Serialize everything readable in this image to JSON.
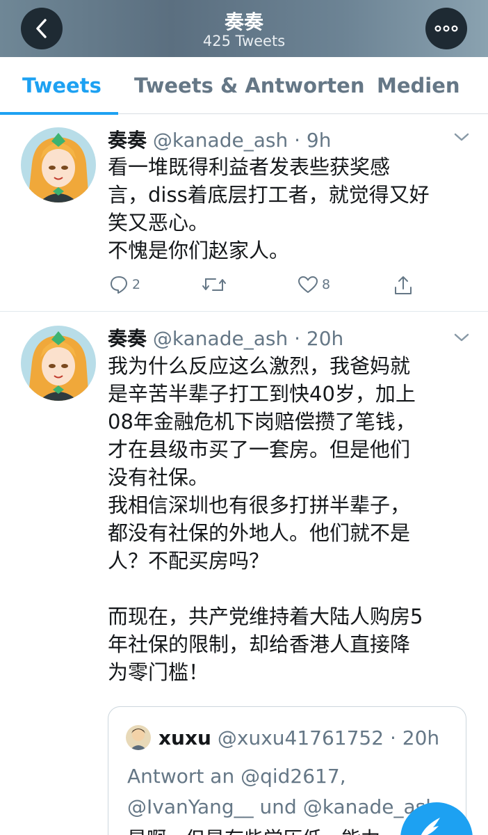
{
  "header": {
    "title": "奏奏",
    "subtitle": "425 Tweets"
  },
  "tabs": [
    {
      "label": "Tweets",
      "active": true
    },
    {
      "label": "Tweets & Antworten",
      "active": false
    },
    {
      "label": "Medien",
      "active": false
    }
  ],
  "tweets": [
    {
      "name": "奏奏",
      "handle": "@kanade_ash · 9h",
      "text": "看一堆既得利益者发表些获奖感\n言，diss着底层打工者，就觉得又好\n笑又恶心。\n不愧是你们赵家人。",
      "replies": "2",
      "retweets": "",
      "likes": "8"
    },
    {
      "name": "奏奏",
      "handle": "@kanade_ash · 20h",
      "text": "我为什么反应这么激烈，我爸妈就\n是辛苦半辈子打工到快40岁，加上\n08年金融危机下岗赔偿攒了笔钱，\n才在县级市买了一套房。但是他们\n没有社保。\n我相信深圳也有很多打拼半辈子，\n都没有社保的外地人。他们就不是\n人？不配买房吗？\n\n而现在，共产党维持着大陆人购房5\n年社保的限制，却给香港人直接降\n为零门槛！",
      "quote": {
        "name": "xuxu",
        "handle": "@xuxu41761752 · 20h",
        "reply_line1": "Antwort an @qid2617,",
        "reply_line2": "@IvanYang__ und @kanade_ash",
        "body": "是啊，但是有些学历低，能力"
      }
    }
  ],
  "colors": {
    "accent": "#1da1f2",
    "secondary_text": "#657786",
    "primary_text": "#14171a"
  },
  "icons": [
    "back-arrow-icon",
    "more-icon",
    "chevron-down-icon",
    "reply-icon",
    "retweet-icon",
    "like-icon",
    "share-icon",
    "compose-icon"
  ]
}
